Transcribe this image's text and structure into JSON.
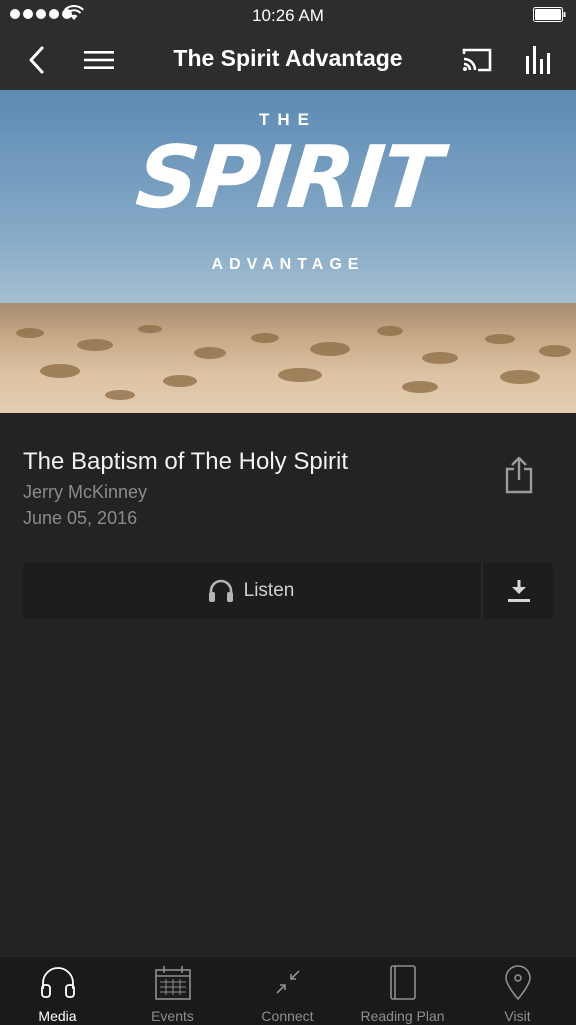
{
  "status_bar": {
    "time": "10:26 AM"
  },
  "nav": {
    "title": "The Spirit Advantage",
    "back_icon": "chevron-left-icon",
    "menu_icon": "hamburger-icon",
    "cast_icon": "cast-icon",
    "stats_icon": "bar-chart-icon"
  },
  "hero": {
    "the": "THE",
    "spirit": "SPIRIT",
    "advantage": "ADVANTAGE"
  },
  "sermon": {
    "title": "The Baptism of The Holy Spirit",
    "speaker": "Jerry McKinney",
    "date": "June 05, 2016"
  },
  "actions": {
    "listen_label": "Listen"
  },
  "tabs": [
    {
      "label": "Media",
      "icon": "headphones-icon",
      "active": true
    },
    {
      "label": "Events",
      "icon": "calendar-icon",
      "active": false
    },
    {
      "label": "Connect",
      "icon": "arrows-in-icon",
      "active": false
    },
    {
      "label": "Reading Plan",
      "icon": "book-icon",
      "active": false
    },
    {
      "label": "Visit",
      "icon": "map-pin-icon",
      "active": false
    }
  ],
  "colors": {
    "background": "#232323",
    "bar": "#2d2d2d",
    "tabbar": "#1a1a1a",
    "muted_text": "#8b8b8b"
  }
}
